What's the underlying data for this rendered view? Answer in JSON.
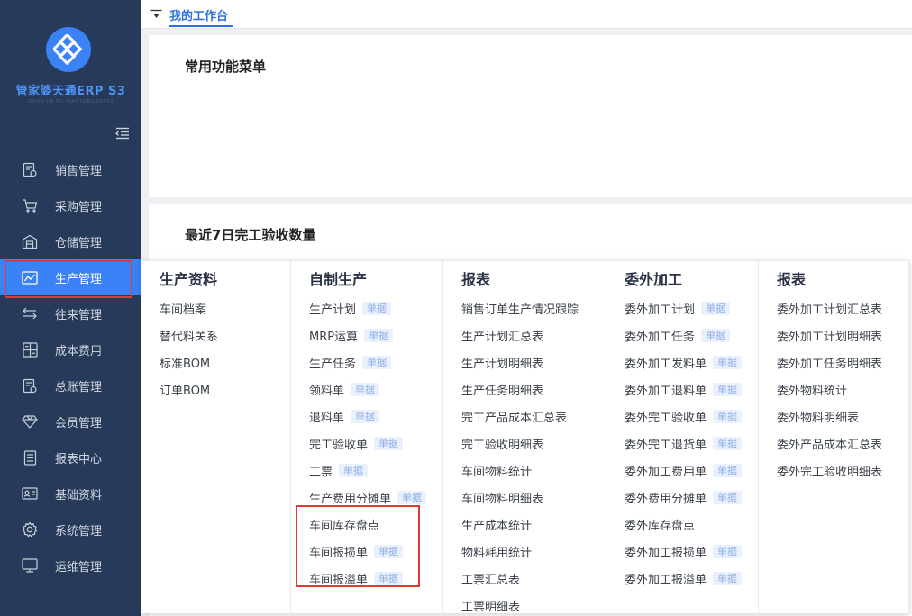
{
  "sidebar": {
    "brand": "管家婆天通ERP S3",
    "brand_sub": "GUAN JIA PO TIANTONGERPS3",
    "items": [
      {
        "label": "销售管理",
        "icon": "sales-doc-icon"
      },
      {
        "label": "采购管理",
        "icon": "cart-icon"
      },
      {
        "label": "仓储管理",
        "icon": "warehouse-icon"
      },
      {
        "label": "生产管理",
        "icon": "production-icon"
      },
      {
        "label": "往来管理",
        "icon": "exchange-icon"
      },
      {
        "label": "成本费用",
        "icon": "calculator-icon"
      },
      {
        "label": "总账管理",
        "icon": "ledger-icon"
      },
      {
        "label": "会员管理",
        "icon": "diamond-icon"
      },
      {
        "label": "报表中心",
        "icon": "report-icon"
      },
      {
        "label": "基础资料",
        "icon": "id-card-icon"
      },
      {
        "label": "系统管理",
        "icon": "gear-icon"
      },
      {
        "label": "运维管理",
        "icon": "monitor-icon"
      }
    ],
    "active_index": 3
  },
  "topbar": {
    "tab_label": "我的工作台"
  },
  "panels": {
    "common_menu_title": "常用功能菜单",
    "recent_title": "最近7日完工验收数量"
  },
  "dropdown": {
    "columns": [
      {
        "title": "生产资料",
        "items": [
          {
            "label": "车间档案",
            "badge": ""
          },
          {
            "label": "替代料关系",
            "badge": ""
          },
          {
            "label": "标准BOM",
            "badge": ""
          },
          {
            "label": "订单BOM",
            "badge": ""
          }
        ]
      },
      {
        "title": "自制生产",
        "items": [
          {
            "label": "生产计划",
            "badge": "单据"
          },
          {
            "label": "MRP运算",
            "badge": "单据"
          },
          {
            "label": "生产任务",
            "badge": "单据"
          },
          {
            "label": "领料单",
            "badge": "单据"
          },
          {
            "label": "退料单",
            "badge": "单据"
          },
          {
            "label": "完工验收单",
            "badge": "单据"
          },
          {
            "label": "工票",
            "badge": "单据"
          },
          {
            "label": "生产费用分摊单",
            "badge": "单据"
          },
          {
            "label": "车间库存盘点",
            "badge": ""
          },
          {
            "label": "车间报损单",
            "badge": "单据"
          },
          {
            "label": "车间报溢单",
            "badge": "单据"
          }
        ]
      },
      {
        "title": "报表",
        "items": [
          {
            "label": "销售订单生产情况跟踪",
            "badge": ""
          },
          {
            "label": "生产计划汇总表",
            "badge": ""
          },
          {
            "label": "生产计划明细表",
            "badge": ""
          },
          {
            "label": "生产任务明细表",
            "badge": ""
          },
          {
            "label": "完工产品成本汇总表",
            "badge": ""
          },
          {
            "label": "完工验收明细表",
            "badge": ""
          },
          {
            "label": "车间物料统计",
            "badge": ""
          },
          {
            "label": "车间物料明细表",
            "badge": ""
          },
          {
            "label": "生产成本统计",
            "badge": ""
          },
          {
            "label": "物料耗用统计",
            "badge": ""
          },
          {
            "label": "工票汇总表",
            "badge": ""
          },
          {
            "label": "工票明细表",
            "badge": ""
          }
        ]
      },
      {
        "title": "委外加工",
        "items": [
          {
            "label": "委外加工计划",
            "badge": "单据"
          },
          {
            "label": "委外加工任务",
            "badge": "单据"
          },
          {
            "label": "委外加工发料单",
            "badge": "单据"
          },
          {
            "label": "委外加工退料单",
            "badge": "单据"
          },
          {
            "label": "委外完工验收单",
            "badge": "单据"
          },
          {
            "label": "委外完工退货单",
            "badge": "单据"
          },
          {
            "label": "委外加工费用单",
            "badge": "单据"
          },
          {
            "label": "委外费用分摊单",
            "badge": "单据"
          },
          {
            "label": "委外库存盘点",
            "badge": ""
          },
          {
            "label": "委外加工报损单",
            "badge": "单据"
          },
          {
            "label": "委外加工报溢单",
            "badge": "单据"
          }
        ]
      },
      {
        "title": "报表",
        "items": [
          {
            "label": "委外加工计划汇总表",
            "badge": ""
          },
          {
            "label": "委外加工计划明细表",
            "badge": ""
          },
          {
            "label": "委外加工任务明细表",
            "badge": ""
          },
          {
            "label": "委外物料统计",
            "badge": ""
          },
          {
            "label": "委外物料明细表",
            "badge": ""
          },
          {
            "label": "委外产品成本汇总表",
            "badge": ""
          },
          {
            "label": "委外完工验收明细表",
            "badge": ""
          }
        ]
      }
    ]
  },
  "colors": {
    "sidebar_bg": "#273a5a",
    "accent": "#3b82f6",
    "highlight": "#e03a3a",
    "badge_text": "#8fb0e8"
  }
}
